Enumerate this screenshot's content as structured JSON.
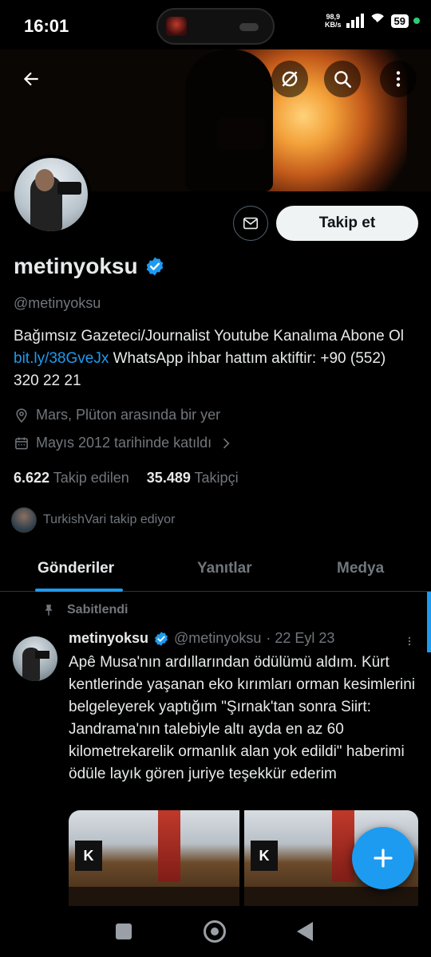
{
  "status_bar": {
    "time": "16:01",
    "network_speed_value": "98,9",
    "network_speed_unit": "KB/s",
    "battery": "59"
  },
  "header": {
    "back_icon": "arrow-left-icon",
    "grok_icon": "slash-circle-icon",
    "search_icon": "search-icon",
    "more_icon": "more-vertical-icon"
  },
  "profile": {
    "display_name": "metinyoksu",
    "verified": true,
    "handle": "@metinyoksu",
    "follow_label": "Takip et",
    "bio_part1": "Bağımsız Gazeteci/Journalist  Youtube Kanalıma Abone Ol ",
    "bio_link": "bit.ly/38GveJx",
    "bio_part2": "  WhatsApp ihbar hattım aktiftir:  +90 (552) 320 22 21",
    "location": "Mars, Plüton arasında bir yer",
    "joined": "Mayıs 2012 tarihinde katıldı",
    "following_count": "6.622",
    "following_label": "Takip edilen",
    "followers_count": "35.489",
    "followers_label": "Takipçi",
    "followed_by": "TurkishVari takip ediyor"
  },
  "tabs": [
    {
      "label": "Gönderiler",
      "active": true
    },
    {
      "label": "Yanıtlar",
      "active": false
    },
    {
      "label": "Medya",
      "active": false
    }
  ],
  "pinned_tweet": {
    "pinned_label": "Sabitlendi",
    "name": "metinyoksu",
    "handle": "@metinyoksu",
    "date": "· 22 Eyl 23",
    "text": "Apê Musa'nın ardıllarından ödülümü aldım. Kürt kentlerinde yaşanan eko kırımları orman kesimlerini belgeleyerek yaptığım \"Şırnak'tan sonra Siirt: Jandrama'nın talebiyle altı ayda en az 60 kilometrekarelik ormanlık alan yok edildi\" haberimi ödüle layık gören juriye teşekkür ederim",
    "media_logo_text": "K"
  },
  "colors": {
    "accent": "#1d9bf0",
    "background": "#000000",
    "muted": "#71767b",
    "text": "#e7e9ea"
  }
}
